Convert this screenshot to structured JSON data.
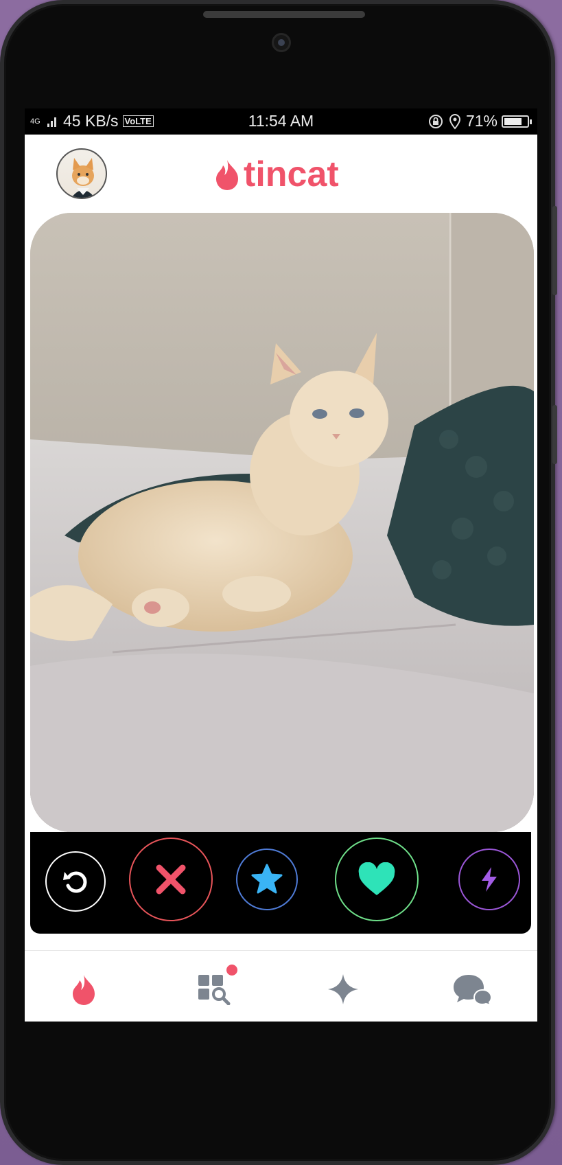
{
  "status": {
    "network_type": "4G",
    "speed": "45 KB/s",
    "volte": "VoLTE",
    "time": "11:54 AM",
    "battery": "71%"
  },
  "app": {
    "brand": "tincat",
    "brand_color": "#f0536a"
  },
  "profile": {
    "photo": "cat-lounging-on-bed"
  },
  "actions": [
    {
      "name": "rewind-icon",
      "color": "#ffffff"
    },
    {
      "name": "nope-icon",
      "color": "#f0536a"
    },
    {
      "name": "super-like-icon",
      "color": "#3ab4f5"
    },
    {
      "name": "like-icon",
      "color": "#2ee3b8"
    },
    {
      "name": "boost-icon",
      "color": "#a35ce6"
    }
  ],
  "tabs": [
    {
      "name": "tab-home",
      "icon": "flame-icon",
      "active": true
    },
    {
      "name": "tab-explore",
      "icon": "explore-icon",
      "notification": true
    },
    {
      "name": "tab-top-picks",
      "icon": "sparkle-icon"
    },
    {
      "name": "tab-messages",
      "icon": "chat-icon"
    }
  ]
}
